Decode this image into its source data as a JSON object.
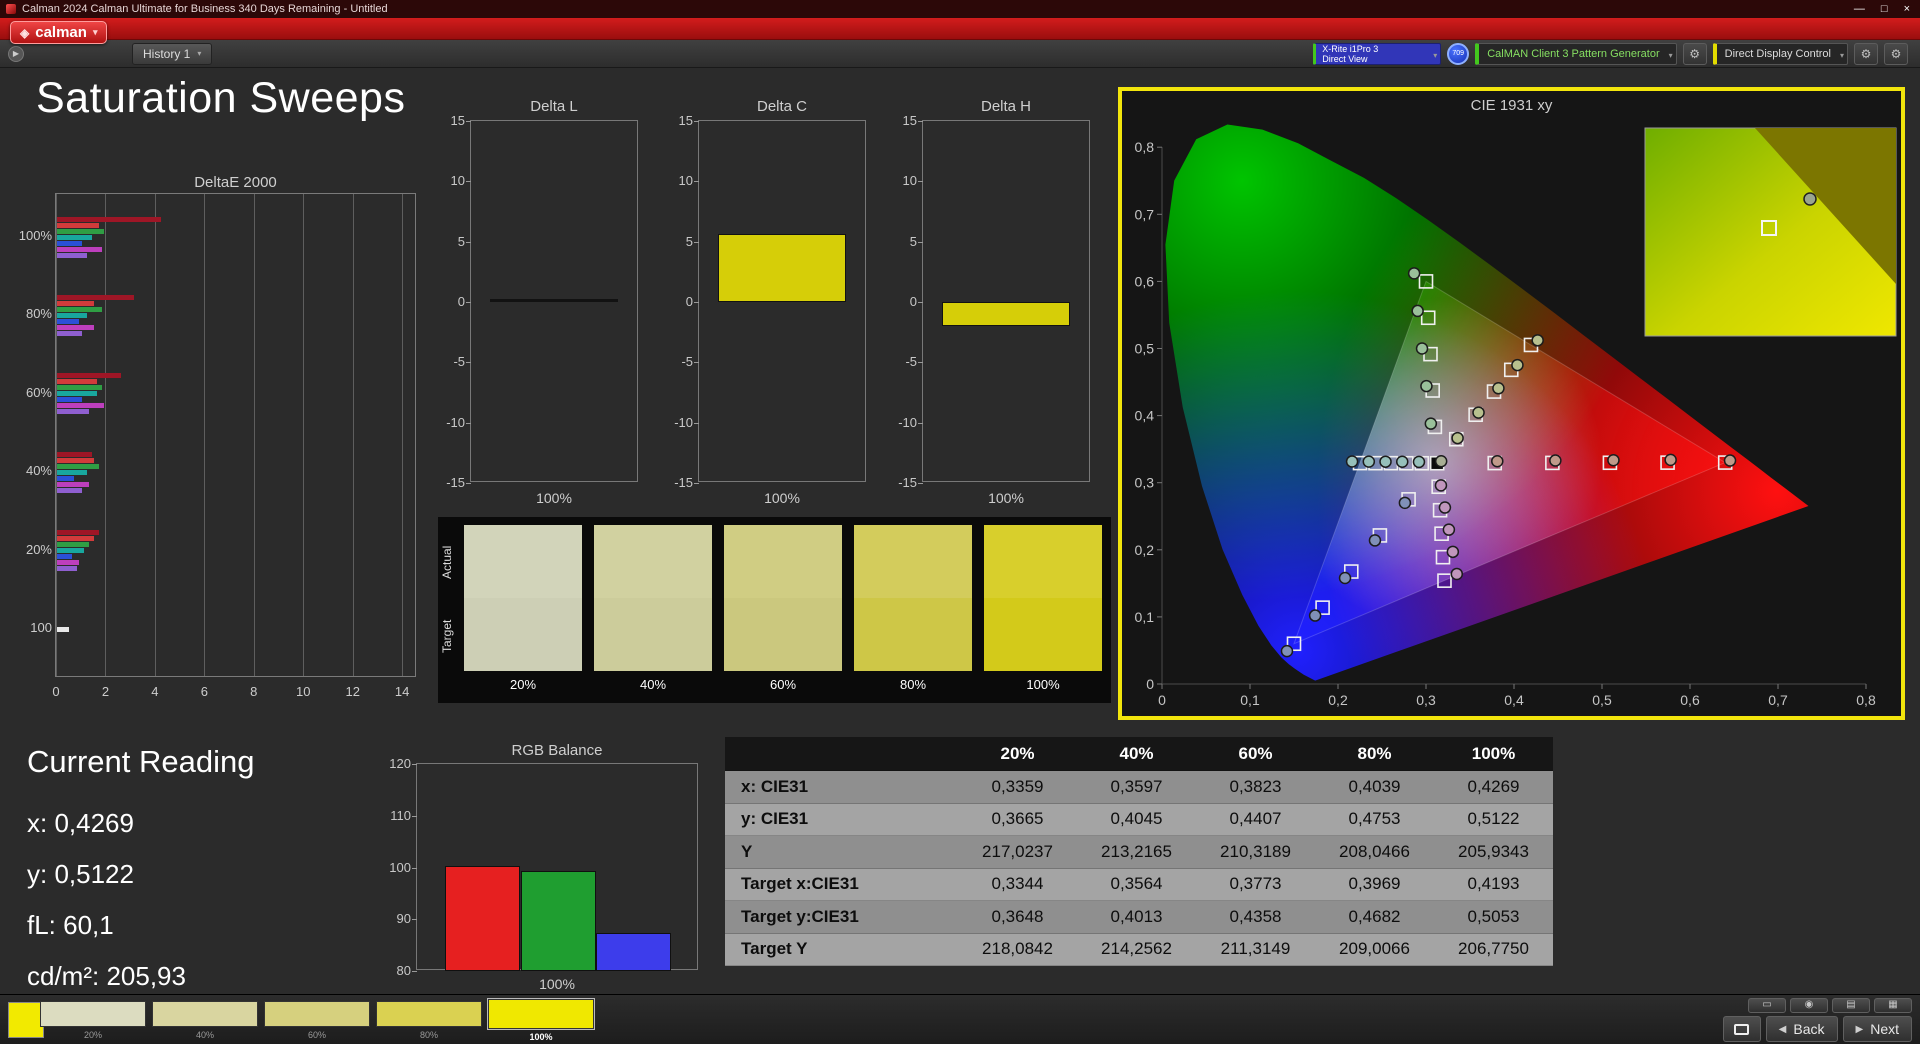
{
  "window": {
    "title": "Calman 2024 Calman Ultimate for Business 340 Days Remaining  - Untitled",
    "minimize": "—",
    "maximize": "□",
    "close": "×"
  },
  "menubar": {
    "logo_label": "calman",
    "logo_icon_glyph": "◈",
    "logo_caret": "▾"
  },
  "toolbar": {
    "nav_glyph": "▶",
    "history_tab": "History 1",
    "caret": "▾",
    "meter": {
      "line1": "X-Rite i1Pro 3",
      "line2": "Direct View"
    },
    "badge": "709",
    "pattern_generator": "CalMAN Client 3 Pattern Generator",
    "display_control": "Direct Display Control",
    "gear_glyph": "⚙"
  },
  "page": {
    "title": "Saturation Sweeps"
  },
  "current_reading": {
    "title": "Current Reading",
    "x": "x: 0,4269",
    "y": "y: 0,5122",
    "fl": "fL: 60,1",
    "cdm2": "cd/m²: 205,93"
  },
  "saturation_swatches": {
    "row_labels": [
      "Actual",
      "Target"
    ],
    "columns": [
      {
        "label": "20%",
        "actual": "#d2d4ba",
        "target": "#cdcfb5"
      },
      {
        "label": "40%",
        "actual": "#d1d1a0",
        "target": "#cccc9b"
      },
      {
        "label": "60%",
        "actual": "#d0cd83",
        "target": "#cbc87e"
      },
      {
        "label": "80%",
        "actual": "#d3cc5c",
        "target": "#cec747"
      },
      {
        "label": "100%",
        "actual": "#d8cf2c",
        "target": "#d3ca1a"
      }
    ]
  },
  "table": {
    "headers": [
      "",
      "20%",
      "40%",
      "60%",
      "80%",
      "100%"
    ],
    "rows": [
      {
        "label": "x: CIE31",
        "values": [
          "0,3359",
          "0,3597",
          "0,3823",
          "0,4039",
          "0,4269"
        ]
      },
      {
        "label": "y: CIE31",
        "values": [
          "0,3665",
          "0,4045",
          "0,4407",
          "0,4753",
          "0,5122"
        ]
      },
      {
        "label": "Y",
        "values": [
          "217,0237",
          "213,2165",
          "210,3189",
          "208,0466",
          "205,9343"
        ]
      },
      {
        "label": "Target x:CIE31",
        "values": [
          "0,3344",
          "0,3564",
          "0,3773",
          "0,3969",
          "0,4193"
        ]
      },
      {
        "label": "Target y:CIE31",
        "values": [
          "0,3648",
          "0,4013",
          "0,4358",
          "0,4682",
          "0,5053"
        ]
      },
      {
        "label": "Target Y",
        "values": [
          "218,0842",
          "214,2562",
          "211,3149",
          "209,0066",
          "206,7750"
        ]
      }
    ]
  },
  "footer": {
    "current_color": "#f2ea00",
    "swatches": [
      {
        "label": "20%",
        "color": "#dcdcc0",
        "selected": false
      },
      {
        "label": "40%",
        "color": "#d9d5a0",
        "selected": false
      },
      {
        "label": "60%",
        "color": "#d6d07e",
        "selected": false
      },
      {
        "label": "80%",
        "color": "#dad151",
        "selected": false
      },
      {
        "label": "100%",
        "color": "#f0e800",
        "selected": true
      }
    ],
    "tools": [
      {
        "name": "monitor-view",
        "glyph": "▭"
      },
      {
        "name": "snapshot",
        "glyph": "◉"
      },
      {
        "name": "report",
        "glyph": "▤"
      },
      {
        "name": "grid-view",
        "glyph": "▦"
      }
    ],
    "pattern_window_glyph": "▢",
    "back_label": "Back",
    "next_label": "Next",
    "back_glyph": "◀",
    "next_glyph": "▶"
  },
  "chart_data": [
    {
      "id": "deltae2000",
      "type": "bar",
      "orientation": "horizontal",
      "title": "DeltaE 2000",
      "xlim": [
        0,
        14
      ],
      "xticks": [
        0,
        2,
        4,
        6,
        8,
        10,
        12,
        14
      ],
      "groups": [
        {
          "label": "100%",
          "bars": [
            {
              "color": "#9e1626",
              "value": 4.2
            },
            {
              "color": "#d23b3b",
              "value": 1.7
            },
            {
              "color": "#2f9e44",
              "value": 1.9
            },
            {
              "color": "#18a79e",
              "value": 1.4
            },
            {
              "color": "#2b50d7",
              "value": 1.0
            },
            {
              "color": "#bd3fbd",
              "value": 1.8
            },
            {
              "color": "#8f5fd0",
              "value": 1.2
            }
          ]
        },
        {
          "label": "80%",
          "bars": [
            {
              "color": "#9e1626",
              "value": 3.1
            },
            {
              "color": "#d23b3b",
              "value": 1.5
            },
            {
              "color": "#2f9e44",
              "value": 1.8
            },
            {
              "color": "#18a79e",
              "value": 1.2
            },
            {
              "color": "#2b50d7",
              "value": 0.9
            },
            {
              "color": "#bd3fbd",
              "value": 1.5
            },
            {
              "color": "#8f5fd0",
              "value": 1.0
            }
          ]
        },
        {
          "label": "60%",
          "bars": [
            {
              "color": "#9e1626",
              "value": 2.6
            },
            {
              "color": "#d23b3b",
              "value": 1.6
            },
            {
              "color": "#2f9e44",
              "value": 1.8
            },
            {
              "color": "#18a79e",
              "value": 1.6
            },
            {
              "color": "#2b50d7",
              "value": 1.0
            },
            {
              "color": "#bd3fbd",
              "value": 1.9
            },
            {
              "color": "#8f5fd0",
              "value": 1.3
            }
          ]
        },
        {
          "label": "40%",
          "bars": [
            {
              "color": "#9e1626",
              "value": 1.4
            },
            {
              "color": "#d23b3b",
              "value": 1.5
            },
            {
              "color": "#2f9e44",
              "value": 1.7
            },
            {
              "color": "#18a79e",
              "value": 1.2
            },
            {
              "color": "#2b50d7",
              "value": 0.7
            },
            {
              "color": "#bd3fbd",
              "value": 1.3
            },
            {
              "color": "#8f5fd0",
              "value": 1.0
            }
          ]
        },
        {
          "label": "20%",
          "bars": [
            {
              "color": "#9e1626",
              "value": 1.7
            },
            {
              "color": "#d23b3b",
              "value": 1.5
            },
            {
              "color": "#2f9e44",
              "value": 1.3
            },
            {
              "color": "#18a79e",
              "value": 1.1
            },
            {
              "color": "#2b50d7",
              "value": 0.6
            },
            {
              "color": "#bd3fbd",
              "value": 0.9
            },
            {
              "color": "#8f5fd0",
              "value": 0.8
            }
          ]
        },
        {
          "label": "100",
          "bars": [
            {
              "color": "#e8e8e8",
              "value": 0.5
            }
          ]
        }
      ]
    },
    {
      "id": "delta_l",
      "type": "bar",
      "title": "Delta L",
      "ylim": [
        -15,
        15
      ],
      "yticks": [
        15,
        10,
        5,
        0,
        -5,
        -10,
        -15
      ],
      "xlabel": "100%",
      "values": [
        0.0
      ],
      "bar_color": "#121212"
    },
    {
      "id": "delta_c",
      "type": "bar",
      "title": "Delta C",
      "ylim": [
        -15,
        15
      ],
      "yticks": [
        15,
        10,
        5,
        0,
        -5,
        -10,
        -15
      ],
      "xlabel": "100%",
      "values": [
        5.6
      ],
      "bar_color": "#d6ce08"
    },
    {
      "id": "delta_h",
      "type": "bar",
      "title": "Delta H",
      "ylim": [
        -15,
        15
      ],
      "yticks": [
        15,
        10,
        5,
        0,
        -5,
        -10,
        -15
      ],
      "xlabel": "100%",
      "values": [
        -2.0
      ],
      "bar_color": "#d6ce08"
    },
    {
      "id": "rgb_balance",
      "type": "bar",
      "title": "RGB Balance",
      "ylim": [
        80,
        120
      ],
      "yticks": [
        120,
        110,
        100,
        90,
        80
      ],
      "xlabel": "100%",
      "categories": [
        "R",
        "G",
        "B"
      ],
      "values": [
        100.3,
        99.4,
        87.3
      ],
      "colors": [
        "#e62020",
        "#1f9e30",
        "#3d3deb"
      ]
    },
    {
      "id": "cie_1931",
      "type": "scatter",
      "title": "CIE 1931 xy",
      "xlim": [
        0,
        0.8
      ],
      "ylim": [
        0,
        0.8
      ],
      "tick_values": [
        0,
        0.1,
        0.2,
        0.3,
        0.4,
        0.5,
        0.6,
        0.7,
        0.8
      ],
      "tick_labels": [
        "0",
        "0,1",
        "0,2",
        "0,3",
        "0,4",
        "0,5",
        "0,6",
        "0,7",
        "0,8"
      ],
      "white_point": [
        0.3127,
        0.329
      ],
      "sweeps": [
        {
          "name": "red",
          "dot": "#c09a8a",
          "target": [
            [
              0.3781,
              0.3292
            ],
            [
              0.4436,
              0.3295
            ],
            [
              0.509,
              0.3297
            ],
            [
              0.5745,
              0.3299
            ],
            [
              0.64,
              0.33
            ]
          ],
          "measured": [
            [
              0.381,
              0.332
            ],
            [
              0.447,
              0.333
            ],
            [
              0.513,
              0.3335
            ],
            [
              0.578,
              0.334
            ],
            [
              0.6455,
              0.333
            ]
          ]
        },
        {
          "name": "green",
          "dot": "#9ac09a",
          "target": [
            [
              0.3101,
              0.3832
            ],
            [
              0.3076,
              0.4374
            ],
            [
              0.3051,
              0.4916
            ],
            [
              0.3025,
              0.5458
            ],
            [
              0.3,
              0.6
            ]
          ],
          "measured": [
            [
              0.3055,
              0.388
            ],
            [
              0.3005,
              0.444
            ],
            [
              0.2955,
              0.5
            ],
            [
              0.2905,
              0.556
            ],
            [
              0.2865,
              0.612
            ]
          ]
        },
        {
          "name": "blue",
          "dot": "#8090b8",
          "target": [
            [
              0.2802,
              0.2752
            ],
            [
              0.2476,
              0.2214
            ],
            [
              0.2151,
              0.1676
            ],
            [
              0.1825,
              0.1138
            ],
            [
              0.15,
              0.06
            ]
          ],
          "measured": [
            [
              0.276,
              0.27
            ],
            [
              0.242,
              0.214
            ],
            [
              0.208,
              0.158
            ],
            [
              0.174,
              0.102
            ],
            [
              0.142,
              0.049
            ]
          ]
        },
        {
          "name": "cyan",
          "dot": "#96c0ba",
          "target": [
            [
              0.2952,
              0.329
            ],
            [
              0.2777,
              0.329
            ],
            [
              0.2601,
              0.3291
            ],
            [
              0.2426,
              0.3291
            ],
            [
              0.225,
              0.3292
            ]
          ],
          "measured": [
            [
              0.292,
              0.331
            ],
            [
              0.273,
              0.3312
            ],
            [
              0.254,
              0.3313
            ],
            [
              0.235,
              0.3314
            ],
            [
              0.216,
              0.3316
            ]
          ]
        },
        {
          "name": "magenta",
          "dot": "#c096bc",
          "target": [
            [
              0.3144,
              0.294
            ],
            [
              0.316,
              0.259
            ],
            [
              0.3177,
              0.224
            ],
            [
              0.3193,
              0.189
            ],
            [
              0.321,
              0.154
            ]
          ],
          "measured": [
            [
              0.317,
              0.296
            ],
            [
              0.3215,
              0.263
            ],
            [
              0.326,
              0.23
            ],
            [
              0.3305,
              0.197
            ],
            [
              0.335,
              0.164
            ]
          ]
        },
        {
          "name": "yellow",
          "dot": "#b8c08e",
          "target": [
            [
              0.3344,
              0.3648
            ],
            [
              0.3564,
              0.4013
            ],
            [
              0.3773,
              0.4358
            ],
            [
              0.3969,
              0.4682
            ],
            [
              0.4193,
              0.5053
            ]
          ],
          "measured": [
            [
              0.3359,
              0.3665
            ],
            [
              0.3597,
              0.4045
            ],
            [
              0.3823,
              0.4407
            ],
            [
              0.4039,
              0.4753
            ],
            [
              0.4269,
              0.5122
            ]
          ]
        }
      ]
    }
  ]
}
